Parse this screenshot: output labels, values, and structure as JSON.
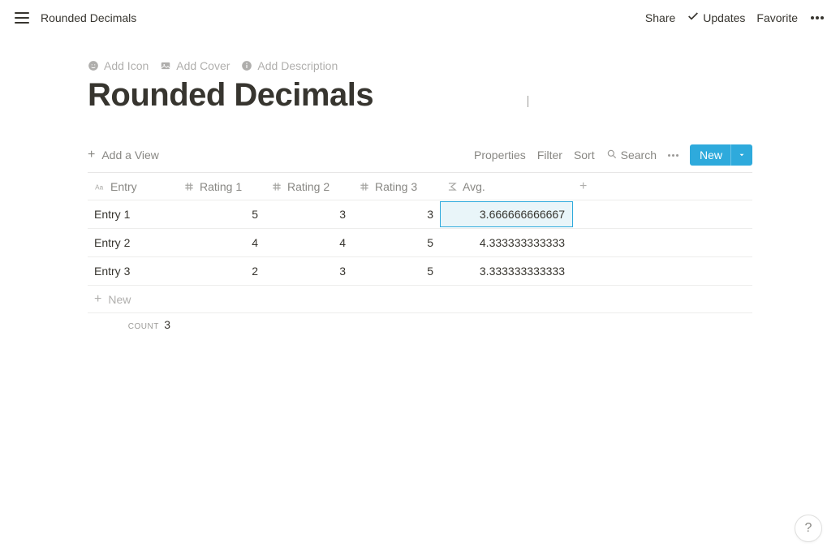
{
  "topbar": {
    "breadcrumb": "Rounded Decimals",
    "share": "Share",
    "updates": "Updates",
    "favorite": "Favorite"
  },
  "page": {
    "add_icon": "Add Icon",
    "add_cover": "Add Cover",
    "add_description": "Add Description",
    "title": "Rounded Decimals"
  },
  "db": {
    "add_view": "Add a View",
    "properties": "Properties",
    "filter": "Filter",
    "sort": "Sort",
    "search": "Search",
    "new": "New"
  },
  "columns": {
    "entry": "Entry",
    "rating1": "Rating 1",
    "rating2": "Rating 2",
    "rating3": "Rating 3",
    "avg": "Avg."
  },
  "rows": [
    {
      "entry": "Entry 1",
      "r1": "5",
      "r2": "3",
      "r3": "3",
      "avg": "3.666666666667"
    },
    {
      "entry": "Entry 2",
      "r1": "4",
      "r2": "4",
      "r3": "5",
      "avg": "4.333333333333"
    },
    {
      "entry": "Entry 3",
      "r1": "2",
      "r2": "3",
      "r3": "5",
      "avg": "3.333333333333"
    }
  ],
  "new_row": "New",
  "footer": {
    "count_label": "COUNT",
    "count_value": "3"
  },
  "help": "?"
}
